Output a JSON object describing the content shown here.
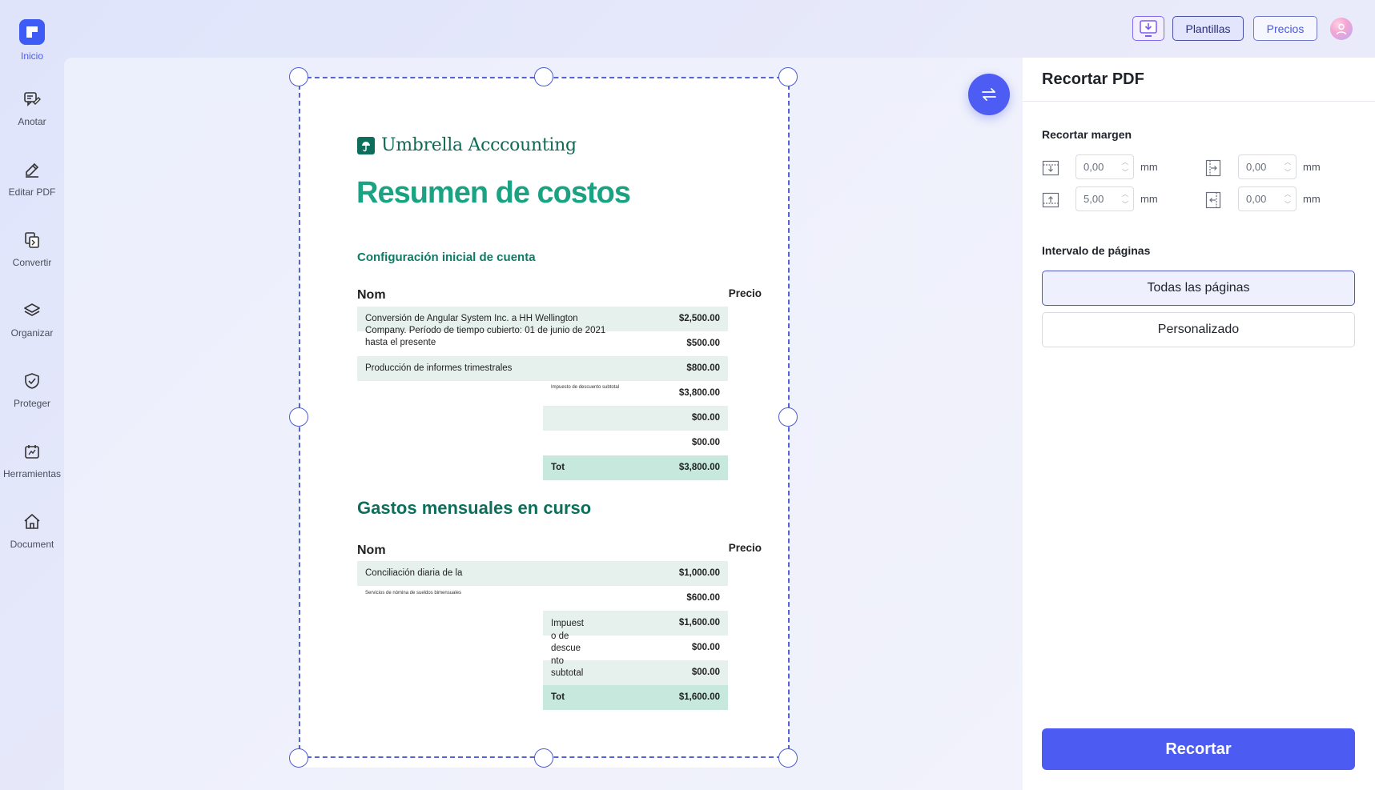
{
  "sidebar": {
    "items": [
      {
        "label": "Inicio",
        "icon": "home-logo-icon",
        "active": true
      },
      {
        "label": "Anotar",
        "icon": "annotate-icon"
      },
      {
        "label": "Editar PDF",
        "icon": "edit-pdf-icon"
      },
      {
        "label": "Convertir",
        "icon": "convert-icon"
      },
      {
        "label": "Organizar",
        "icon": "layers-icon"
      },
      {
        "label": "Proteger",
        "icon": "shield-icon"
      },
      {
        "label": "Herramientas",
        "icon": "tools-icon"
      },
      {
        "label": "Document",
        "icon": "house-icon"
      }
    ]
  },
  "topbar": {
    "download_icon": "download-to-desktop-icon",
    "plantillas_label": "Plantillas",
    "precios_label": "Precios",
    "avatar_icon": "user-avatar-icon"
  },
  "document": {
    "brand": "Umbrella Acccounting",
    "title": "Resumen de costos",
    "section1": {
      "heading": "Configuración inicial de cuenta",
      "col_name": "Nom",
      "col_price": "Precio",
      "desc1_lines": [
        "Conversión de Angular System Inc. a HH Wellington",
        "Company. Período de tiempo cubierto: 01 de junio de 2021",
        "hasta el presente"
      ],
      "price1": "$2,500.00",
      "price2": "$500.00",
      "desc3": "Producción de informes trimestrales",
      "price3": "$800.00",
      "tiny_label": "Impuesto de descuento subtotal",
      "price4": "$3,800.00",
      "price5": "$00.00",
      "price6": "$00.00",
      "total_label": "Tot",
      "total": "$3,800.00"
    },
    "section2": {
      "heading": "Gastos mensuales en curso",
      "col_name": "Nom",
      "col_price": "Precio",
      "desc1": "Conciliación diaria de la",
      "price1": "$1,000.00",
      "tiny_desc2": "Servicios de nómina de sueldos bimensuales",
      "price2": "$600.00",
      "side_lines": [
        "Impuest",
        "o de",
        "descue",
        "nto",
        "subtotal"
      ],
      "price3": "$1,600.00",
      "price4": "$00.00",
      "price5": "$00.00",
      "total_label": "Tot",
      "total": "$1,600.00"
    }
  },
  "panel": {
    "title": "Recortar PDF",
    "margin_label": "Recortar margen",
    "margins": {
      "top": "0,00",
      "left": "0,00",
      "bottom": "5,00",
      "right": "0,00",
      "unit": "mm"
    },
    "range_label": "Intervalo de páginas",
    "range_all": "Todas las páginas",
    "range_custom": "Personalizado",
    "crop_button": "Recortar"
  },
  "colors": {
    "accent": "#4c5cf2",
    "doc_green": "#1aa383",
    "doc_dark_green": "#0d6e5b",
    "row_shade": "#e6f1ed",
    "row_total": "#c6e8dd"
  }
}
